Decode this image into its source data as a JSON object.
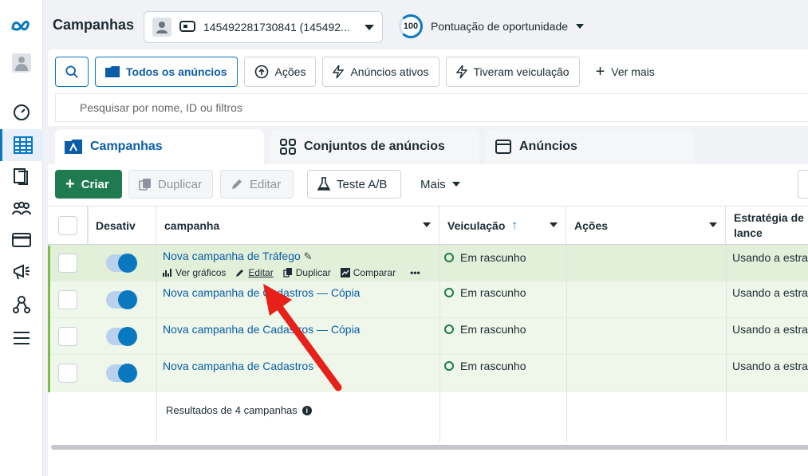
{
  "colors": {
    "accent": "#0a78be",
    "create": "#1f7a4f",
    "row_bg": "#eef7e9",
    "arrow": "#e8201a"
  },
  "rail": [
    {
      "icon": "meta-logo-icon"
    },
    {
      "icon": "avatar-icon"
    },
    {
      "icon": "gauge-icon"
    },
    {
      "icon": "table-grid-icon"
    },
    {
      "icon": "pages-icon"
    },
    {
      "icon": "audience-icon"
    },
    {
      "icon": "billing-card-icon"
    },
    {
      "icon": "megaphone-icon"
    },
    {
      "icon": "network-icon"
    },
    {
      "icon": "menu-icon"
    }
  ],
  "header": {
    "title": "Campanhas",
    "account": "145492281730841 (145492...",
    "score_value": "100",
    "score_label": "Pontuação de oportunidade"
  },
  "filters": {
    "all_ads": "Todos os anúncios",
    "actions": "Ações",
    "active_ads": "Anúncios ativos",
    "delivered": "Tiveram veiculação",
    "see_more": "Ver mais"
  },
  "search": {
    "placeholder": "Pesquisar por nome, ID ou filtros"
  },
  "tabs": {
    "campaigns": "Campanhas",
    "adsets": "Conjuntos de anúncios",
    "ads": "Anúncios"
  },
  "toolbar": {
    "create": "Criar",
    "duplicate": "Duplicar",
    "edit": "Editar",
    "ab_test": "Teste A/B",
    "more": "Mais"
  },
  "table": {
    "columns": {
      "toggle": "Desativ",
      "campaign": "campanha",
      "delivery": "Veiculação",
      "actions": "Ações",
      "strategy_line1": "Estratégia de",
      "strategy_line2": "lance"
    },
    "rows": [
      {
        "name": "Nova campanha de Tráfego",
        "status": "Em rascunho",
        "strategy": "Usando a estrat"
      },
      {
        "name": "Nova campanha de Cadastros — Cópia",
        "status": "Em rascunho",
        "strategy": "Usando a estrat"
      },
      {
        "name": "Nova campanha de Cadastros — Cópia",
        "status": "Em rascunho",
        "strategy": "Usando a estrat"
      },
      {
        "name": "Nova campanha de Cadastros",
        "status": "Em rascunho",
        "strategy": "Usando a estrat"
      }
    ],
    "row_actions": {
      "charts": "Ver gráficos",
      "edit": "Editar",
      "duplicate": "Duplicar",
      "compare": "Comparar",
      "more": "•••"
    },
    "results": "Resultados de 4 campanhas"
  }
}
